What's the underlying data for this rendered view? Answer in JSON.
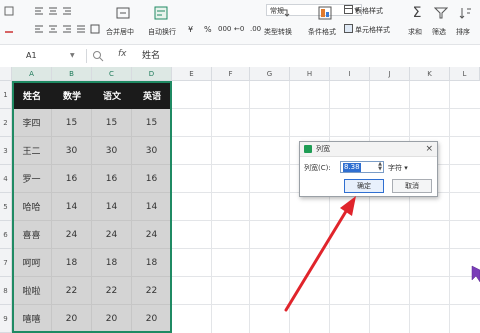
{
  "ribbon": {
    "font_name": "常规",
    "labels": {
      "merge_center": "合并居中",
      "wrap_text": "自动换行",
      "type_convert": "类型转换",
      "conditional_format": "条件格式",
      "table_style": "表格样式",
      "cell_style": "单元格样式",
      "sum": "求和",
      "filter": "筛选",
      "sort": "排序"
    },
    "number_format_symbols": [
      "¥",
      "%",
      "000",
      "←0",
      ".00"
    ]
  },
  "formula_bar": {
    "name_box": "A1",
    "fx": "fx",
    "content": "姓名"
  },
  "grid": {
    "columns": [
      "A",
      "B",
      "C",
      "D",
      "E",
      "F",
      "G",
      "H",
      "I",
      "J",
      "K",
      "L"
    ],
    "rows": [
      "1",
      "2",
      "3",
      "4",
      "5",
      "6",
      "7",
      "8",
      "9"
    ],
    "table": {
      "headers": [
        "姓名",
        "数学",
        "语文",
        "英语"
      ],
      "rows": [
        [
          "李四",
          "15",
          "15",
          "15"
        ],
        [
          "王二",
          "30",
          "30",
          "30"
        ],
        [
          "罗一",
          "16",
          "16",
          "16"
        ],
        [
          "哈哈",
          "14",
          "14",
          "14"
        ],
        [
          "喜喜",
          "24",
          "24",
          "24"
        ],
        [
          "呵呵",
          "18",
          "18",
          "18"
        ],
        [
          "啦啦",
          "22",
          "22",
          "22"
        ],
        [
          "嘻嘻",
          "20",
          "20",
          "20"
        ]
      ]
    }
  },
  "dialog": {
    "title": "列宽",
    "close": "×",
    "label": "列宽(C):",
    "value": "8.38",
    "unit": "字符 ▾",
    "ok": "确定",
    "cancel": "取消"
  },
  "colors": {
    "accent_green": "#1f8a63",
    "header_black": "#1b1b1b",
    "cell_gray": "#d4d4d4",
    "arrow_red": "#e0242b"
  }
}
